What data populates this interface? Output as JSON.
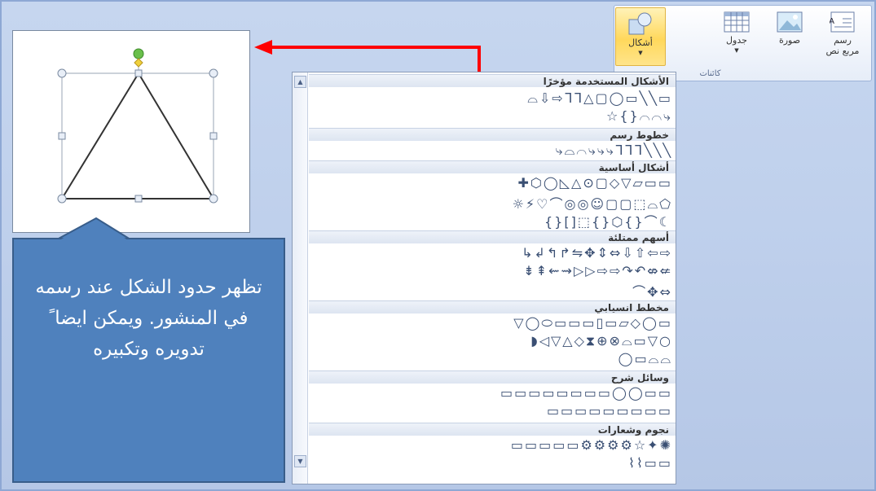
{
  "ribbon": {
    "buttons": [
      {
        "name": "text-box",
        "label": "رسم\nمربع نص"
      },
      {
        "name": "picture",
        "label": "صورة"
      },
      {
        "name": "table",
        "label": "جدول"
      },
      {
        "name": "shapes",
        "label": "أشكال"
      }
    ],
    "group_label": "كائنات"
  },
  "callout": {
    "text": "تظهر حدود الشكل عند رسمه في المنشور. ويمكن ايضا ً تدويره وتكبيره"
  },
  "gallery": {
    "categories": [
      {
        "title": "الأشكال المستخدمة مؤخرًا",
        "rows": [
          "▭╲╲▭◯▢△ᒣᒣ⇨⇩⌓",
          "⤷⌒⌒{}☆"
        ]
      },
      {
        "title": "خطوط رسم",
        "rows": [
          "╲╲╲ᒣᒣᒣ⤷⤷⤷⌒⌓⤷"
        ]
      },
      {
        "title": "أشكال أساسية",
        "rows": [
          "▭▭▱▽◇▢⊙△◺◯⬡✚",
          "⬠⌓⬚▢▢☺◎◎⌒♡⚡☼",
          "☾⌒{}⬡{}⬚[]{}"
        ]
      },
      {
        "title": "أسهم ممتلئة",
        "rows": [
          "⇨⇦⇧⇩⇔⇕✥⇋↱↰↲↳",
          "⇍⇎↶↷⇨⇨▷▷⇝⇜⇞⇟",
          "⇔✥⌒"
        ]
      },
      {
        "title": "مخطط انسيابي",
        "rows": [
          "▭◯◇▱▭▯▭▭▭⬭◯▽",
          "○▽▭⌓⊗⊕⧗◇△▽◁◗",
          "⌓⌓▭◯"
        ]
      },
      {
        "title": "وسائل شرح",
        "rows": [
          "▭▭◯◯▭▭▭▭▭▭▭▭",
          "▭▭▭▭▭▭▭▭▭"
        ]
      },
      {
        "title": "نجوم وشعارات",
        "rows": [
          "✺✦☆⚙⚙⚙⚙▭▭▭▭▭",
          "▭▭⌇⌇"
        ]
      }
    ]
  },
  "colors": {
    "accent": "#4f81bd",
    "arrow": "#ff0000",
    "handle_green": "#6abf4b",
    "handle_yellow": "#f0d03c"
  }
}
